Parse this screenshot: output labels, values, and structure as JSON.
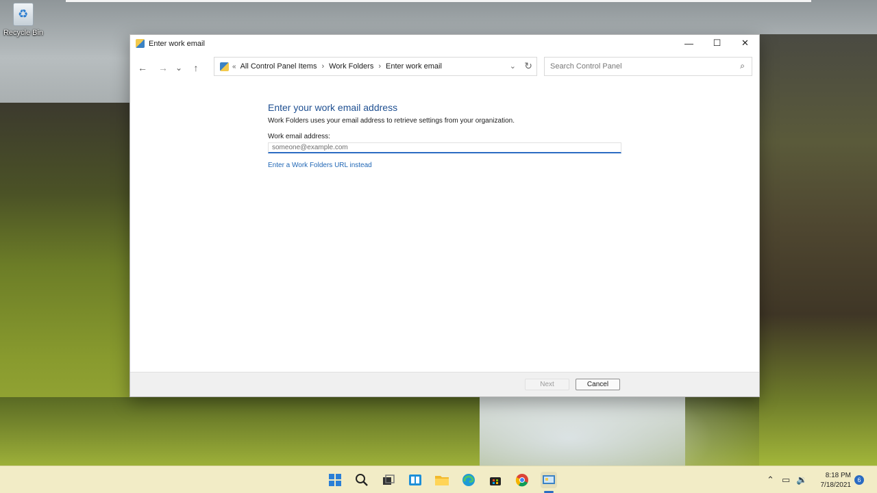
{
  "desktop": {
    "recycle_bin_label": "Recycle Bin"
  },
  "window": {
    "title": "Enter work email",
    "controls": {
      "minimize": "—",
      "maximize": "☐",
      "close": "✕"
    }
  },
  "nav": {
    "back": "←",
    "forward": "→",
    "recent": "⌄",
    "up": "↑",
    "breadcrumb_lead": "«",
    "breadcrumbs": [
      "All Control Panel Items",
      "Work Folders",
      "Enter work email"
    ],
    "separator": "›",
    "dropdown": "⌄",
    "refresh": "↻"
  },
  "search": {
    "placeholder": "Search Control Panel",
    "icon": "⌕"
  },
  "content": {
    "heading": "Enter your work email address",
    "description": "Work Folders uses your email address to retrieve settings from your organization.",
    "email_label": "Work email address:",
    "email_placeholder": "someone@example.com",
    "alt_link": "Enter a Work Folders URL instead"
  },
  "footer": {
    "next_label": "Next",
    "cancel_label": "Cancel"
  },
  "taskbar": {
    "icons": [
      "start-icon",
      "search-icon",
      "task-view-icon",
      "widgets-icon",
      "file-explorer-icon",
      "edge-icon",
      "store-icon",
      "chrome-icon",
      "control-panel-icon"
    ],
    "tray": {
      "chevron": "⌃",
      "network": "▭",
      "volume": "🔉"
    },
    "time": "8:18 PM",
    "date": "7/18/2021",
    "notification_count": "6"
  },
  "colors": {
    "accent": "#2a6bc2",
    "heading": "#1e4f91",
    "link": "#1f66b5",
    "taskbar": "#f2ecc6"
  }
}
